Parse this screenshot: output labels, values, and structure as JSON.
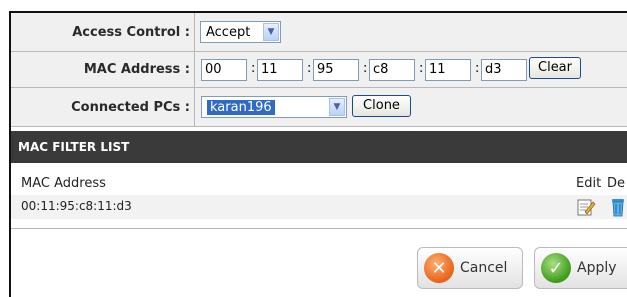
{
  "access_control": {
    "label": "Access Control :",
    "value": "Accept"
  },
  "mac_address": {
    "label": "MAC Address :",
    "octets": [
      "00",
      "11",
      "95",
      "c8",
      "11",
      "d3"
    ],
    "separator": ":",
    "clear_label": "Clear"
  },
  "connected_pcs": {
    "label": "Connected PCs :",
    "value": "karan196",
    "clone_label": "Clone"
  },
  "filter_list": {
    "title": "MAC FILTER LIST",
    "columns": {
      "mac": "MAC Address",
      "edit": "Edit",
      "delete": "De"
    },
    "rows": [
      {
        "mac": "00:11:95:c8:11:d3"
      }
    ]
  },
  "actions": {
    "cancel_label": "Cancel",
    "apply_label": "Apply"
  },
  "icons": [
    "chevron-down-icon",
    "edit-icon",
    "trash-icon",
    "cancel-icon",
    "checkmark-icon"
  ],
  "colors": {
    "header_bg": "#3a3a3a",
    "cancel_accent": "#e8621a",
    "apply_accent": "#3d9a1c"
  }
}
